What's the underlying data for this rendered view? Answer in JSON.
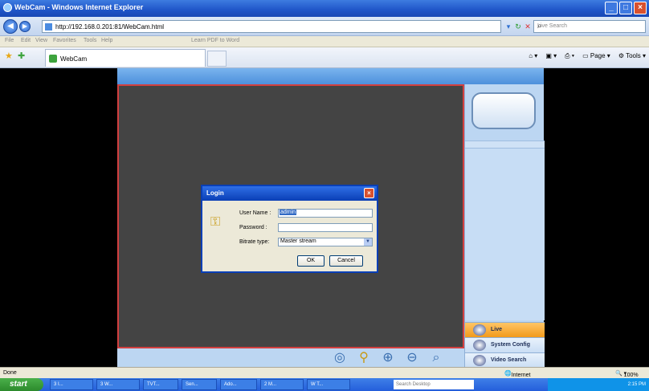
{
  "window": {
    "title": "WebCam - Windows Internet Explorer"
  },
  "address": {
    "url": "http://192.168.0.201:81/WebCam.html",
    "search_placeholder": "Live Search"
  },
  "menu": {
    "items": [
      "File",
      "Edit",
      "View",
      "Favorites",
      "Tools",
      "Help"
    ],
    "pdf_label": "Learn PDF to Word"
  },
  "tabs": {
    "active": "WebCam"
  },
  "toolbar": {
    "page": "Page",
    "tools": "Tools"
  },
  "side_menu": {
    "live": "Live",
    "system_config": "System Config",
    "video_search": "Video Search"
  },
  "login": {
    "title": "Login",
    "username_label": "User Name :",
    "username_value": "admin",
    "password_label": "Password :",
    "password_value": "",
    "bitrate_label": "Bitrate type:",
    "bitrate_value": "Master stream",
    "ok_label": "OK",
    "cancel_label": "Cancel"
  },
  "status": {
    "left": "Done",
    "zone": "Internet",
    "zoom": "100%"
  },
  "taskbar": {
    "start": "start",
    "search_placeholder": "Search Desktop",
    "time": "2:15 PM",
    "tasks": [
      "3 I...",
      "3 W...",
      "TVT...",
      "Sen...",
      "Ado...",
      "2 M...",
      "W T..."
    ]
  },
  "colors": {
    "accent": "#0a3fb5",
    "live_tab": "#f29a1c",
    "video_border": "#d24040"
  }
}
